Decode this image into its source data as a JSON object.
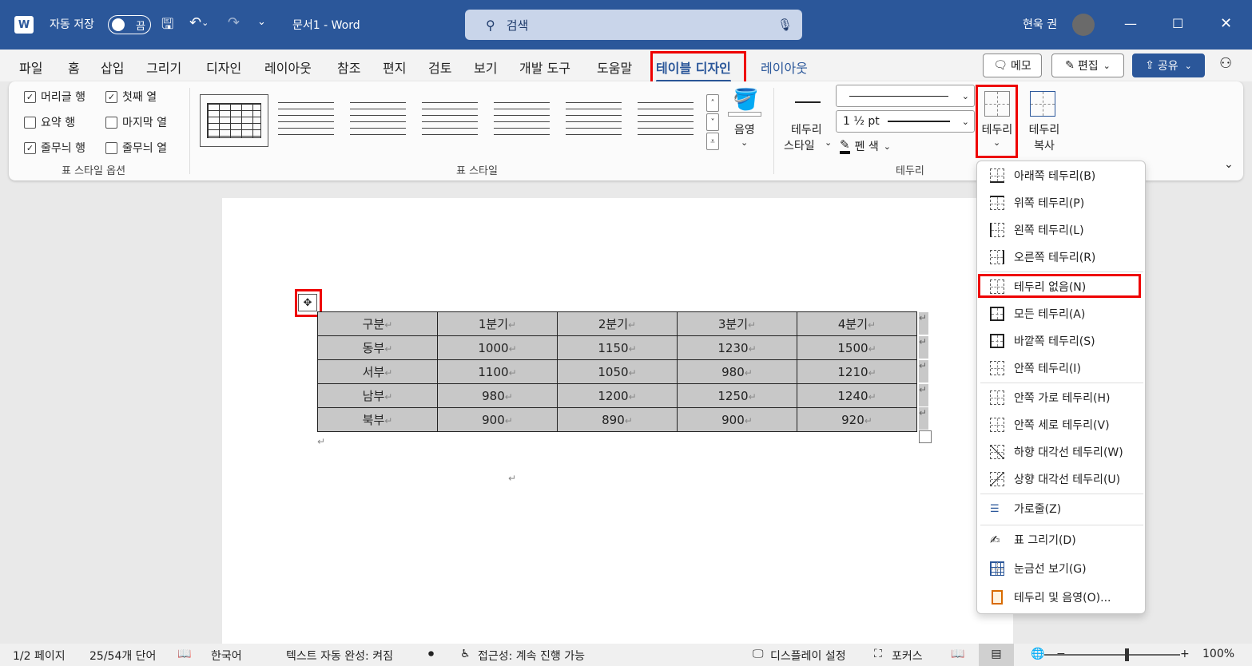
{
  "titlebar": {
    "autosave_label": "자동 저장",
    "autosave_state": "끔",
    "doc_title": "문서1  -  Word",
    "search_placeholder": "검색",
    "user_name": "현욱 권"
  },
  "menubar": {
    "tabs": [
      "파일",
      "홈",
      "삽입",
      "그리기",
      "디자인",
      "레이아웃",
      "참조",
      "편지",
      "검토",
      "보기",
      "개발 도구",
      "도움말",
      "테이블 디자인",
      "레이아웃"
    ],
    "memo_label": "메모",
    "edit_label": "편집",
    "share_label": "공유"
  },
  "ribbon": {
    "style_options": {
      "items": [
        {
          "label": "머리글 행",
          "checked": true
        },
        {
          "label": "첫째 열",
          "checked": true
        },
        {
          "label": "요약 행",
          "checked": false
        },
        {
          "label": "마지막 열",
          "checked": false
        },
        {
          "label": "줄무늬 행",
          "checked": true
        },
        {
          "label": "줄무늬 열",
          "checked": false
        }
      ],
      "group_label": "표 스타일 옵션"
    },
    "table_styles_label": "표 스타일",
    "shading_label": "음영",
    "border_style_label_1": "테두리",
    "border_style_label_2": "스타일",
    "line_weight": "1 ½ pt",
    "pen_color_label": "펜 색",
    "borders_btn_label": "테두리",
    "border_painter_label_1": "테두리",
    "border_painter_label_2": "복사",
    "borders_group_label": "테두리"
  },
  "table": {
    "header": [
      "구분",
      "1분기",
      "2분기",
      "3분기",
      "4분기"
    ],
    "rows": [
      [
        "동부",
        "1000",
        "1150",
        "1230",
        "1500"
      ],
      [
        "서부",
        "1100",
        "1050",
        "980",
        "1210"
      ],
      [
        "남부",
        "980",
        "1200",
        "1250",
        "1240"
      ],
      [
        "북부",
        "900",
        "890",
        "900",
        "920"
      ]
    ]
  },
  "borders_menu": {
    "items": [
      "아래쪽 테두리(B)",
      "위쪽 테두리(P)",
      "왼쪽 테두리(L)",
      "오른쪽 테두리(R)",
      "테두리 없음(N)",
      "모든 테두리(A)",
      "바깥쪽 테두리(S)",
      "안쪽 테두리(I)",
      "안쪽 가로 테두리(H)",
      "안쪽 세로 테두리(V)",
      "하향 대각선 테두리(W)",
      "상향 대각선 테두리(U)",
      "가로줄(Z)",
      "표 그리기(D)",
      "눈금선 보기(G)",
      "테두리 및 음영(O)..."
    ]
  },
  "statusbar": {
    "page": "1/2 페이지",
    "words": "25/54개 단어",
    "language": "한국어",
    "autocomplete": "텍스트 자동 완성: 켜짐",
    "accessibility": "접근성: 계속 진행 가능",
    "display_settings": "디스플레이 설정",
    "focus": "포커스",
    "zoom": "100%"
  },
  "colors": {
    "accent": "#2b579a",
    "highlight": "#e00000",
    "cell_shade": "#c8c8c8"
  }
}
